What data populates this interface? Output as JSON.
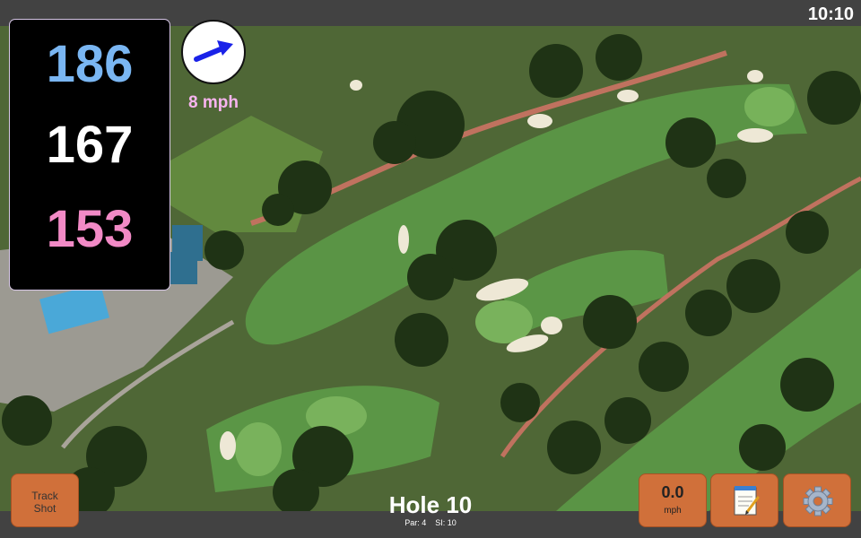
{
  "status_bar": {
    "time": "10:10"
  },
  "distances": {
    "back": "186",
    "center": "167",
    "front": "153"
  },
  "wind": {
    "speed_label": "8 mph",
    "arrow_icon": "arrow-right-icon"
  },
  "buttons": {
    "track_shot_line1": "Track",
    "track_shot_line2": "Shot",
    "speed_value": "0.0",
    "speed_unit": "mph",
    "notes_icon": "notepad-icon",
    "settings_icon": "gear-icon"
  },
  "hole": {
    "title": "Hole 10",
    "par_label": "Par: 4",
    "si_label": "SI: 10"
  },
  "colors": {
    "back_distance": "#7ab6f2",
    "center_distance": "#ffffff",
    "front_distance": "#f28ac6",
    "wind_arrow": "#1a22e8",
    "button": "#d0703a"
  }
}
